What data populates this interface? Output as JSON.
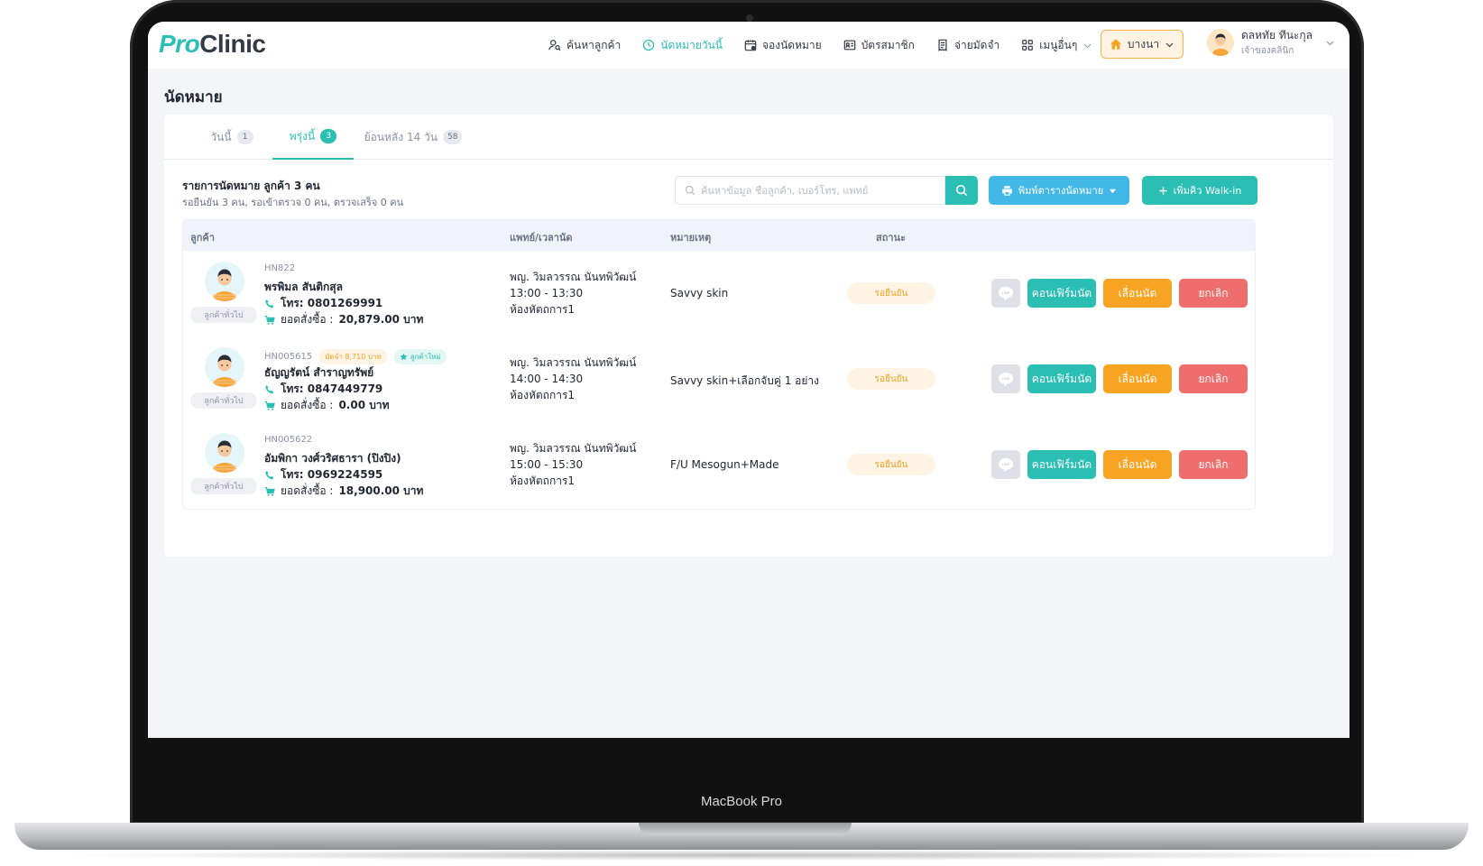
{
  "device": {
    "label": "MacBook Pro"
  },
  "app": {
    "logo_pro": "Pro",
    "logo_clinic": "Clinic"
  },
  "nav": [
    {
      "label": "ค้นหาลูกค้า",
      "icon": "user-search-icon",
      "active": false
    },
    {
      "label": "นัดหมายวันนี้",
      "icon": "clock-icon",
      "active": true
    },
    {
      "label": "จองนัดหมาย",
      "icon": "calendar-icon",
      "active": false
    },
    {
      "label": "บัตรสมาชิก",
      "icon": "card-icon",
      "active": false
    },
    {
      "label": "จ่ายมัดจำ",
      "icon": "receipt-icon",
      "active": false
    },
    {
      "label": "เมนูอื่นๆ",
      "icon": "grid-icon",
      "active": false
    }
  ],
  "branch": {
    "label": "บางนา"
  },
  "user": {
    "name": "ดลหทัย ทีนะกุล",
    "role": "เจ้าของคลินิก"
  },
  "page": {
    "title": "นัดหมาย"
  },
  "tabs": [
    {
      "label": "วันนี้",
      "count": "1",
      "active": false
    },
    {
      "label": "พรุ่งนี้",
      "count": "3",
      "active": true
    },
    {
      "label": "ย้อนหลัง 14 วัน",
      "count": "58",
      "active": false
    }
  ],
  "summary": {
    "title": "รายการนัดหมาย ลูกค้า 3 คน",
    "sub": "รอยืนยัน 3 คน, รอเข้าตรวจ 0 คน, ตรวจเสร็จ 0 คน"
  },
  "search": {
    "placeholder": "ค้นหาข้อมูล ชื่อลูกค้า, เบอร์โทร, แพทย์"
  },
  "buttons": {
    "print": "พิมพ์ตารางนัดหมาย",
    "walkin": "เพิ่มคิว Walk-in"
  },
  "table": {
    "headers": {
      "customer": "ลูกค้า",
      "doctor": "แพทย์/เวลานัด",
      "note": "หมายเหตุ",
      "status": "สถานะ"
    },
    "actions": {
      "line": "LINE",
      "confirm": "คอนเฟิร์มนัด",
      "postpone": "เลื่อนนัด",
      "cancel": "ยกเลิก"
    },
    "rows": [
      {
        "hn": "HN822",
        "deposit": "",
        "new_badge": "",
        "name": "พรพิมล สันติกสุล",
        "phone": "โทร: 0801269991",
        "purchase_label": "ยอดสั่งซื้อ :",
        "purchase": "20,879.00 บาท",
        "type": "ลูกค้าทั่วไป",
        "doctor": "พญ. วิมลวรรณ นันทพิวัฒน์",
        "time": "13:00 - 13:30",
        "room": "ห้องหัตถการ1",
        "note": "Savvy skin",
        "status": "รอยืนยัน"
      },
      {
        "hn": "HN005615",
        "deposit": "มัดจำ 8,710 บาท",
        "new_badge": "ลูกค้าใหม่",
        "name": "ธัญญรัตน์ สำราญทรัพย์",
        "phone": "โทร: 0847449779",
        "purchase_label": "ยอดสั่งซื้อ :",
        "purchase": "0.00 บาท",
        "type": "ลูกค้าทั่วไป",
        "doctor": "พญ. วิมลวรรณ นันทพิวัฒน์",
        "time": "14:00 - 14:30",
        "room": "ห้องหัตถการ1",
        "note": "Savvy skin+เลือกจับคู่ 1 อย่าง",
        "status": "รอยืนยัน"
      },
      {
        "hn": "HN005622",
        "deposit": "",
        "new_badge": "",
        "name": "อัมพิกา วงศ์วริศธารา (ปิงปิง)",
        "phone": "โทร: 0969224595",
        "purchase_label": "ยอดสั่งซื้อ :",
        "purchase": "18,900.00 บาท",
        "type": "ลูกค้าทั่วไป",
        "doctor": "พญ. วิมลวรรณ นันทพิวัฒน์",
        "time": "15:00 - 15:30",
        "room": "ห้องหัตถการ1",
        "note": "F/U Mesogun+Made",
        "status": "รอยืนยัน"
      }
    ]
  },
  "colors": {
    "accent": "#2bbfb3",
    "print_button": "#42b8e8",
    "postpone_button": "#f8a423",
    "cancel_button": "#ee6d6d",
    "pending_status": "#f0a22a"
  }
}
